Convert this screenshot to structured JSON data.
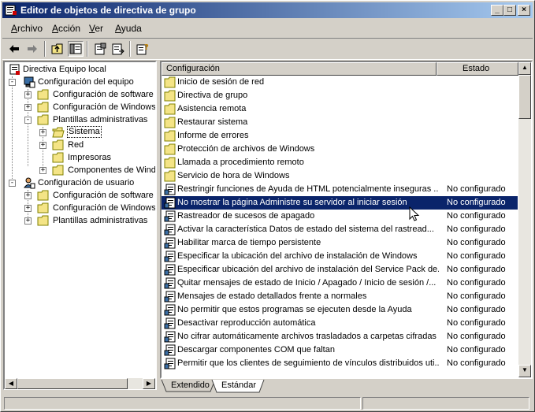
{
  "window": {
    "title": "Editor de objetos de directiva de grupo"
  },
  "menu": {
    "items": [
      {
        "label": "Archivo",
        "accel": "A",
        "rest": "rchivo"
      },
      {
        "label": "Acción",
        "accel": "A",
        "rest": "cción"
      },
      {
        "label": "Ver",
        "accel": "V",
        "rest": "er"
      },
      {
        "label": "Ayuda",
        "accel": "A",
        "rest": "yuda"
      }
    ]
  },
  "toolbar": {
    "icons": [
      "back-arrow-icon",
      "forward-arrow-icon",
      "up-folder-icon",
      "show-tree-icon",
      "properties-icon",
      "export-list-icon",
      "help-icon"
    ]
  },
  "tree": {
    "root": "Directiva Equipo local",
    "computer": "Configuración del equipo",
    "software": "Configuración de software",
    "windows": "Configuración de Windows",
    "admin": "Plantillas administrativas",
    "sistema": "Sistema",
    "red": "Red",
    "impresoras": "Impresoras",
    "componentes": "Componentes de Windo",
    "user": "Configuración de usuario",
    "u_software": "Configuración de software",
    "u_windows": "Configuración de Windows",
    "u_admin": "Plantillas administrativas"
  },
  "list": {
    "col_config": "Configuración",
    "col_state": "Estado",
    "rows": [
      {
        "type": "folder",
        "text": "Inicio de sesión de red",
        "state": ""
      },
      {
        "type": "folder",
        "text": "Directiva de grupo",
        "state": ""
      },
      {
        "type": "folder",
        "text": "Asistencia remota",
        "state": ""
      },
      {
        "type": "folder",
        "text": "Restaurar sistema",
        "state": ""
      },
      {
        "type": "folder",
        "text": "Informe de errores",
        "state": ""
      },
      {
        "type": "folder",
        "text": "Protección de archivos de Windows",
        "state": ""
      },
      {
        "type": "folder",
        "text": "Llamada a procedimiento remoto",
        "state": ""
      },
      {
        "type": "folder",
        "text": "Servicio de hora de Windows",
        "state": ""
      },
      {
        "type": "policy",
        "text": "Restringir funciones de Ayuda de HTML potencialmente inseguras ...",
        "state": "No configurado"
      },
      {
        "type": "policy",
        "text": "No mostrar la página Administre su servidor al iniciar sesión",
        "state": "No configurado"
      },
      {
        "type": "policy",
        "text": "Rastreador de sucesos de apagado",
        "state": "No configurado"
      },
      {
        "type": "policy",
        "text": "Activar la característica Datos de estado del sistema del rastread...",
        "state": "No configurado"
      },
      {
        "type": "policy",
        "text": "Habilitar marca de tiempo persistente",
        "state": "No configurado"
      },
      {
        "type": "policy",
        "text": "Especificar la ubicación del archivo de instalación de Windows",
        "state": "No configurado"
      },
      {
        "type": "policy",
        "text": "Especificar ubicación del archivo de instalación del Service Pack de...",
        "state": "No configurado"
      },
      {
        "type": "policy",
        "text": "Quitar mensajes de estado de Inicio / Apagado / Inicio de sesión /...",
        "state": "No configurado"
      },
      {
        "type": "policy",
        "text": "Mensajes de estado detallados frente a normales",
        "state": "No configurado"
      },
      {
        "type": "policy",
        "text": "No permitir que estos programas se ejecuten desde la Ayuda",
        "state": "No configurado"
      },
      {
        "type": "policy",
        "text": "Desactivar reproducción automática",
        "state": "No configurado"
      },
      {
        "type": "policy",
        "text": "No cifrar automáticamente archivos trasladados a carpetas cifradas",
        "state": "No configurado"
      },
      {
        "type": "policy",
        "text": "Descargar componentes COM que faltan",
        "state": "No configurado"
      },
      {
        "type": "policy",
        "text": "Permitir que los clientes de seguimiento de vínculos distribuidos uti...",
        "state": "No configurado"
      }
    ]
  },
  "tabs": {
    "extended": "Extendido",
    "standard": "Estándar"
  },
  "colors": {
    "titlebar_start": "#0a246a",
    "titlebar_end": "#a6caf0",
    "selection": "#0a246a",
    "face": "#d4d0c8",
    "folder": "#f4e486"
  }
}
